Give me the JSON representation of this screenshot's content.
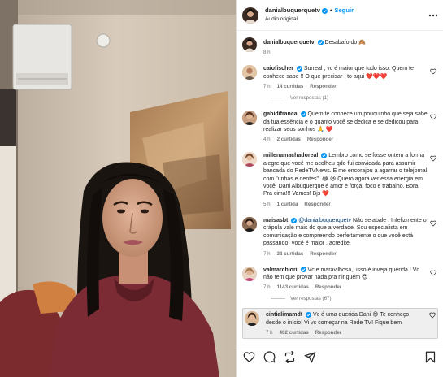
{
  "post": {
    "username": "danialbuquerquetv",
    "follow_label": "Seguir",
    "audio": "Áudio original",
    "separator": "•"
  },
  "caption": {
    "username": "danialbuquerquetv",
    "text": "Desabafo do",
    "emoji": "🙈",
    "time": "8 h"
  },
  "comments": [
    {
      "username": "caiofischer",
      "text": "Surreal , vc é maior que tudo isso. Quem te conhece sabe !! O que precisar , to aqui",
      "emoji": "❤️❤️❤️",
      "time": "7 h",
      "likes": "14 curtidas",
      "reply": "Responder",
      "replies": "Ver respostas (1)"
    },
    {
      "username": "gabidifranca",
      "text": "Quem te conhece um pouquinho que seja sabe da tua essência e o quanto você se dedica e se dedicou para realizar seus sonhos",
      "emoji": "🙏 ❤️",
      "time": "4 h",
      "likes": "2 curtidas",
      "reply": "Responder"
    },
    {
      "username": "millenamachadoreal",
      "text": "Lembro como se fosse ontem a forma alegre que você me acolheu qdo fui convidada para assumir bancada do RedeTVNews. E me encorajou a agarrar o telejornal com \"unhas e dentes\".",
      "text2": "Quero agora ver essa energia em você! Dani Albuquerque é amor e força, foco e trabalho. Bora! Pra cima!!! Vamos! Bjs",
      "emoji": "😂 😆",
      "emoji2": "❤️",
      "time": "5 h",
      "likes": "1 curtida",
      "reply": "Responder"
    },
    {
      "username": "maisasbt",
      "mention": "@danialbuquerquetv",
      "text": "Não se abale . Infelizmente o crápula vale mais do que a verdade. Sou especialista em comunicação e compreendo perfeitamente o que você está passando. Você é maior , acredite.",
      "time": "7 h",
      "likes": "33 curtidas",
      "reply": "Responder"
    },
    {
      "username": "valmarchiori",
      "text": "Vc e maravilhosa,, isso é inveja querida ! Vc não tem que provar nada pra ninguém",
      "emoji": "😍",
      "time": "7 h",
      "likes": "1143 curtidas",
      "reply": "Responder",
      "replies": "Ver respostas (67)"
    },
    {
      "username": "cintialimamdt",
      "text": "Vc é uma querida Dani",
      "emoji": "😍",
      "text2": "Te conheço desde o início! Vi vc começar na Rede TV! Fique bem",
      "time": "7 h",
      "likes": "402 curtidas",
      "reply": "Responder"
    }
  ],
  "icons": {
    "like": "heart-icon",
    "comment": "comment-icon",
    "share": "share-icon",
    "send": "send-icon",
    "save": "bookmark-icon"
  },
  "colors": {
    "link": "#0095f6",
    "verified": "#0095f6",
    "muted": "#737373",
    "heart": "#ed4956"
  }
}
